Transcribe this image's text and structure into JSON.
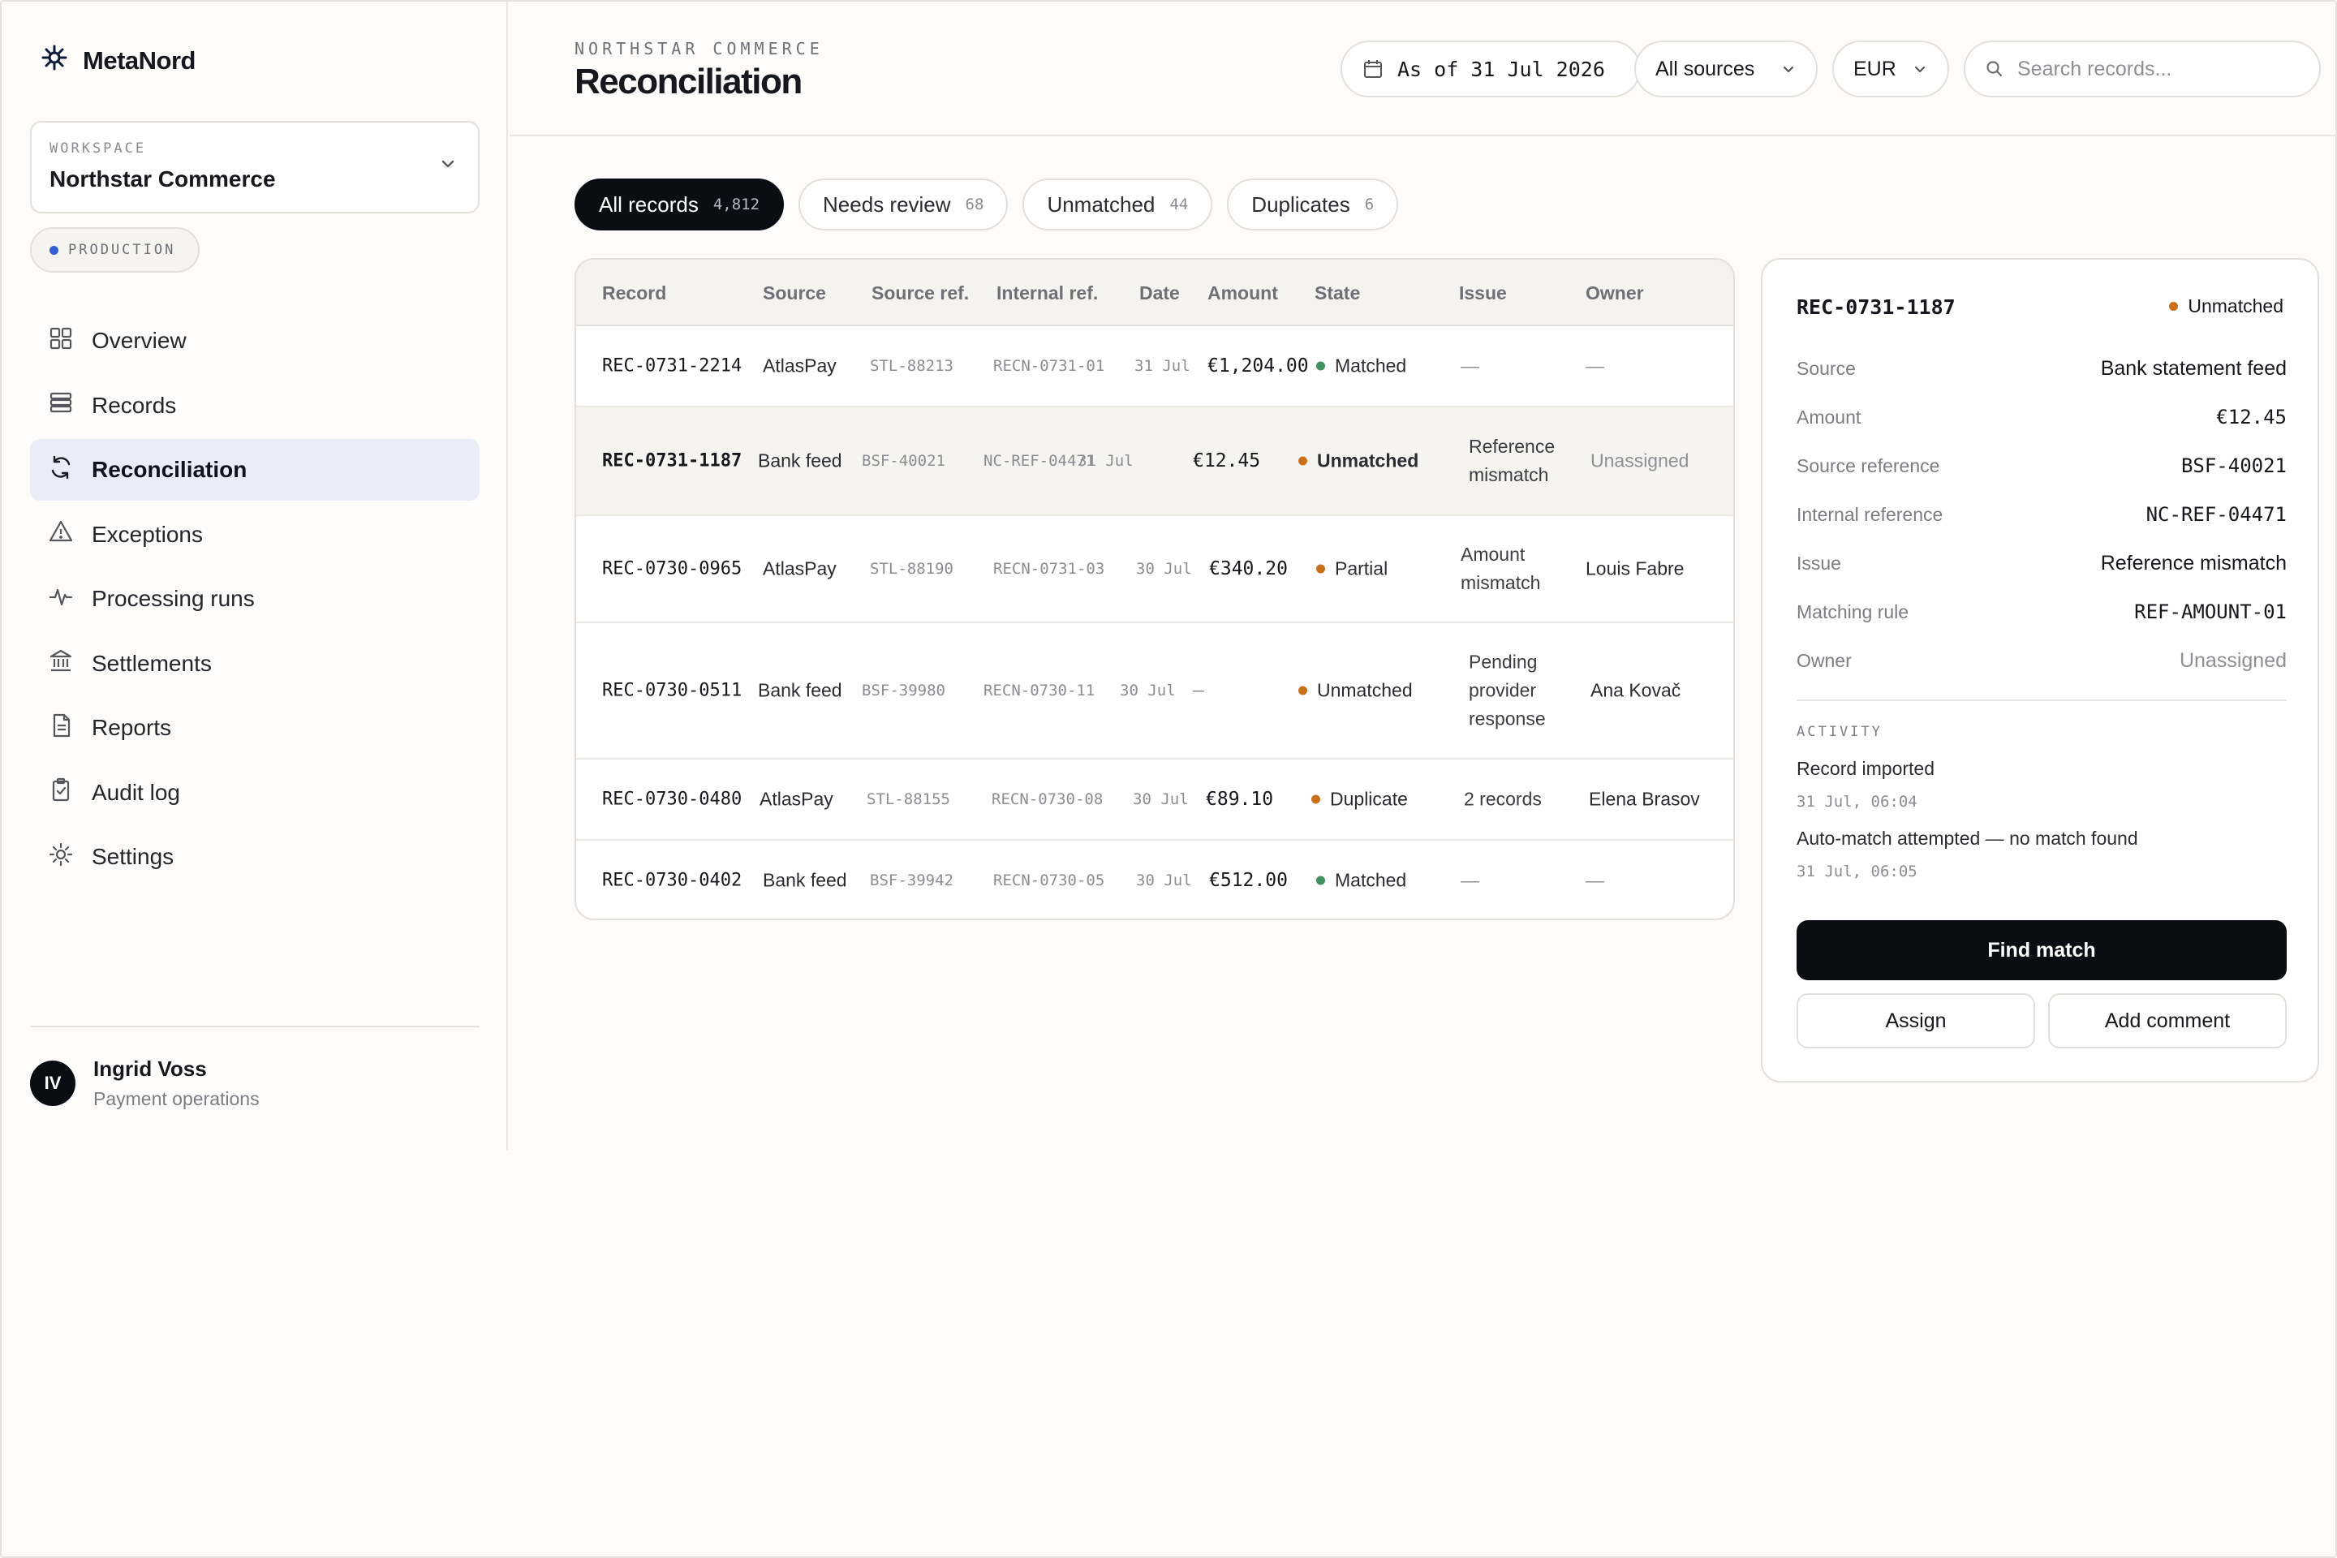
{
  "brand": {
    "name": "MetaNord"
  },
  "workspace": {
    "label": "WORKSPACE",
    "name": "Northstar Commerce",
    "environment": "PRODUCTION"
  },
  "nav": [
    {
      "label": "Overview",
      "icon": "grid-icon"
    },
    {
      "label": "Records",
      "icon": "stack-icon"
    },
    {
      "label": "Reconciliation",
      "icon": "refresh-icon",
      "active": true
    },
    {
      "label": "Exceptions",
      "icon": "warning-icon"
    },
    {
      "label": "Processing runs",
      "icon": "activity-icon"
    },
    {
      "label": "Settlements",
      "icon": "bank-icon"
    },
    {
      "label": "Reports",
      "icon": "document-icon"
    },
    {
      "label": "Audit log",
      "icon": "clipboard-icon"
    },
    {
      "label": "Settings",
      "icon": "gear-icon"
    }
  ],
  "user": {
    "initials": "IV",
    "name": "Ingrid Voss",
    "role": "Payment operations"
  },
  "header": {
    "eyebrow": "NORTHSTAR COMMERCE",
    "title": "Reconciliation",
    "date_filter": "As of 31 Jul 2026",
    "source_filter": "All sources",
    "currency": "EUR",
    "search_placeholder": "Search records..."
  },
  "tabs": [
    {
      "label": "All records",
      "count": "4,812",
      "active": true
    },
    {
      "label": "Needs review",
      "count": "68"
    },
    {
      "label": "Unmatched",
      "count": "44"
    },
    {
      "label": "Duplicates",
      "count": "6"
    }
  ],
  "table": {
    "columns": [
      "Record",
      "Source",
      "Source ref.",
      "Internal ref.",
      "Date",
      "Amount",
      "State",
      "Issue",
      "Owner"
    ],
    "rows": [
      {
        "record": "REC-0731-2214",
        "source": "AtlasPay",
        "source_ref": "STL-88213",
        "internal_ref": "RECN-0731-01",
        "date": "31 Jul",
        "amount": "€1,204.00",
        "state": "Matched",
        "state_color": "#3f8f5f",
        "issue": "—",
        "owner": "—"
      },
      {
        "record": "REC-0731-1187",
        "source": "Bank feed",
        "source_ref": "BSF-40021",
        "internal_ref": "NC-REF-04471",
        "date": "31 Jul",
        "amount": "€12.45",
        "state": "Unmatched",
        "state_color": "#c9711a",
        "issue": "Reference mismatch",
        "owner": "Unassigned",
        "selected": true
      },
      {
        "record": "REC-0730-0965",
        "source": "AtlasPay",
        "source_ref": "STL-88190",
        "internal_ref": "RECN-0731-03",
        "date": "30 Jul",
        "amount": "€340.20",
        "state": "Partial",
        "state_color": "#c9711a",
        "issue": "Amount mismatch",
        "owner": "Louis Fabre"
      },
      {
        "record": "REC-0730-0511",
        "source": "Bank feed",
        "source_ref": "BSF-39980",
        "internal_ref": "RECN-0730-11",
        "date": "30 Jul",
        "amount": "—",
        "state": "Unmatched",
        "state_color": "#c9711a",
        "issue": "Pending provider response",
        "owner": "Ana Kovač"
      },
      {
        "record": "REC-0730-0480",
        "source": "AtlasPay",
        "source_ref": "STL-88155",
        "internal_ref": "RECN-0730-08",
        "date": "30 Jul",
        "amount": "€89.10",
        "state": "Duplicate",
        "state_color": "#c9711a",
        "issue": "2 records",
        "owner": "Elena Brasov"
      },
      {
        "record": "REC-0730-0402",
        "source": "Bank feed",
        "source_ref": "BSF-39942",
        "internal_ref": "RECN-0730-05",
        "date": "30 Jul",
        "amount": "€512.00",
        "state": "Matched",
        "state_color": "#3f8f5f",
        "issue": "—",
        "owner": "—"
      }
    ]
  },
  "detail": {
    "title": "REC-0731-1187",
    "status": "Unmatched",
    "status_color": "#c9711a",
    "fields": [
      {
        "key": "Source",
        "value": "Bank statement feed"
      },
      {
        "key": "Amount",
        "value": "€12.45",
        "mono": true
      },
      {
        "key": "Source reference",
        "value": "BSF-40021",
        "mono": true
      },
      {
        "key": "Internal reference",
        "value": "NC-REF-04471",
        "mono": true
      },
      {
        "key": "Issue",
        "value": "Reference mismatch"
      },
      {
        "key": "Matching rule",
        "value": "REF-AMOUNT-01",
        "mono": true
      },
      {
        "key": "Owner",
        "value": "Unassigned",
        "muted": true
      }
    ],
    "activity_label": "ACTIVITY",
    "activity": [
      {
        "text": "Record imported",
        "time": "31 Jul, 06:04"
      },
      {
        "text": "Auto-match attempted — no match found",
        "time": "31 Jul, 06:05"
      }
    ],
    "primary_action": "Find match",
    "assign_action": "Assign",
    "comment_action": "Add comment"
  }
}
